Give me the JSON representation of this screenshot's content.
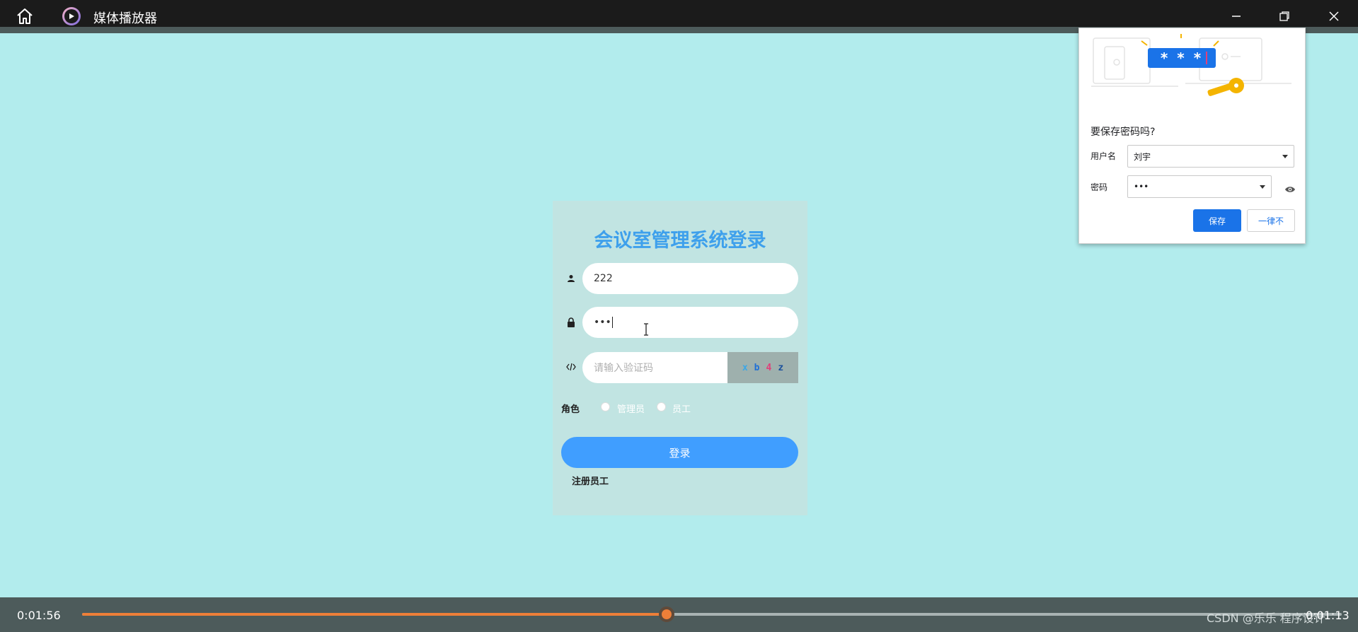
{
  "window": {
    "title": "媒体播放器"
  },
  "login": {
    "title": "会议室管理系统登录",
    "username_value": "222",
    "password_value": "•••",
    "captcha_placeholder": "请输入验证码",
    "captcha_chars": [
      "x",
      "b",
      "4",
      "z"
    ],
    "role_label": "角色",
    "role_options": [
      "管理员",
      "员工"
    ],
    "login_button": "登录",
    "register_link": "注册员工"
  },
  "save_password": {
    "illustration_text": "* * *",
    "heading": "要保存密码吗?",
    "username_label": "用户名",
    "username_value": "刘宇",
    "password_label": "密码",
    "password_value": "•••",
    "save_button": "保存",
    "never_button": "一律不"
  },
  "player": {
    "current_time": "0:01:56",
    "total_time": "0:01:13",
    "progress": 0.464,
    "watermark": "CSDN @乐乐 程序设计"
  },
  "colors": {
    "background": "#b2eced",
    "title": "#3ea0ec",
    "accent": "#ee7f38",
    "button": "#409eff"
  }
}
